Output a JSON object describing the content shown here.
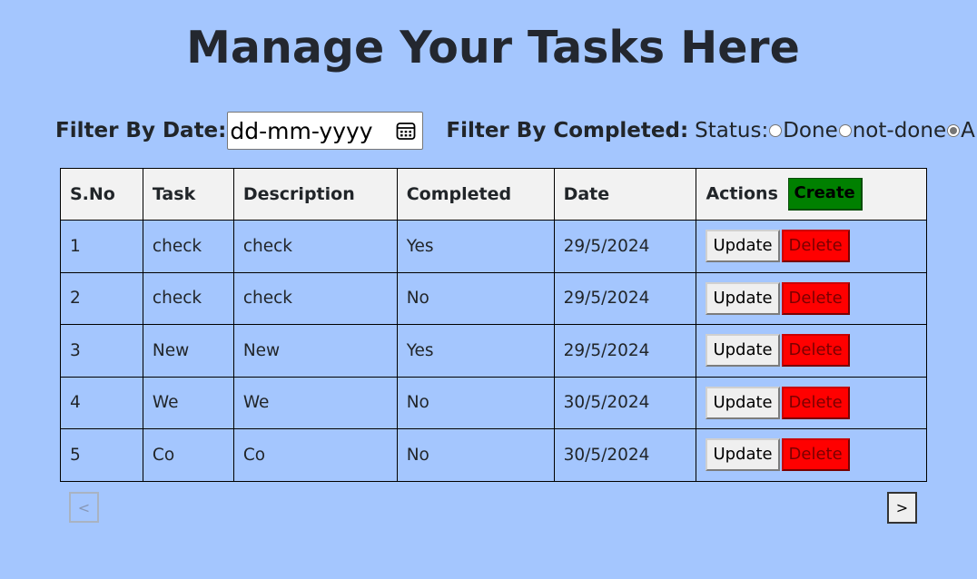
{
  "page": {
    "title": "Manage Your Tasks Here"
  },
  "filters": {
    "date_label": "Filter By Date:",
    "date_placeholder": "dd-mm-yyyy",
    "completed_label": "Filter By Completed:",
    "status_label": "Status:",
    "options": [
      {
        "label": "Done",
        "checked": false
      },
      {
        "label": "not-done",
        "checked": false
      },
      {
        "label": "All",
        "checked": true
      }
    ]
  },
  "table": {
    "headers": [
      "S.No",
      "Task",
      "Description",
      "Completed",
      "Date",
      "Actions"
    ],
    "create_label": "Create",
    "update_label": "Update",
    "delete_label": "Delete",
    "rows": [
      {
        "sno": "1",
        "task": "check",
        "description": "check",
        "completed": "Yes",
        "date": "29/5/2024"
      },
      {
        "sno": "2",
        "task": "check",
        "description": "check",
        "completed": "No",
        "date": "29/5/2024"
      },
      {
        "sno": "3",
        "task": "New",
        "description": "New",
        "completed": "Yes",
        "date": "29/5/2024"
      },
      {
        "sno": "4",
        "task": "We",
        "description": "We",
        "completed": "No",
        "date": "30/5/2024"
      },
      {
        "sno": "5",
        "task": "Co",
        "description": "Co",
        "completed": "No",
        "date": "30/5/2024"
      }
    ]
  },
  "pagination": {
    "prev_label": "<",
    "next_label": ">"
  },
  "colors": {
    "background": "#a4c6fe",
    "create_button": "#008000",
    "delete_button": "#ff0000",
    "header_row": "#f2f2f2"
  },
  "icons": {
    "date_picker": "calendar-icon"
  }
}
